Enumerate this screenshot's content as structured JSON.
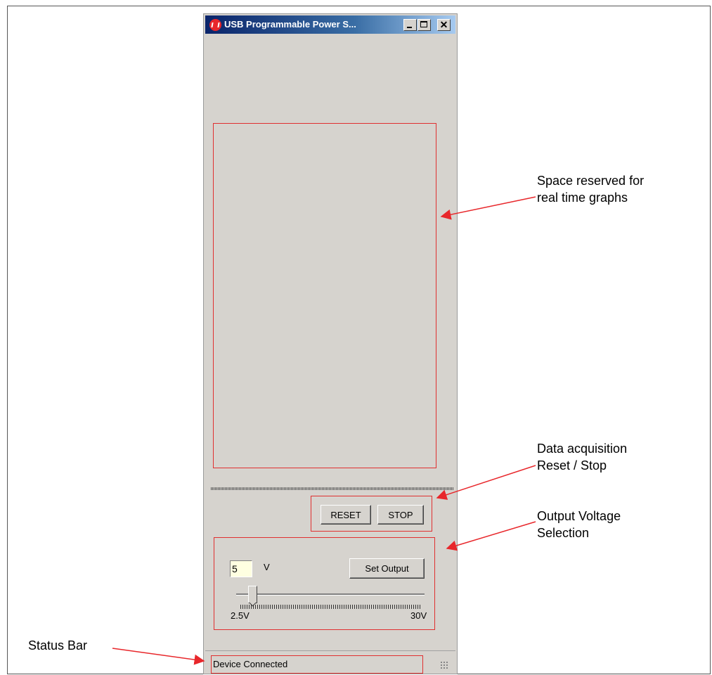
{
  "window": {
    "title": "USB Programmable Power S...",
    "logo_icon": "microchip-logo-icon",
    "titlebar_buttons": [
      "minimize",
      "maximize",
      "close"
    ],
    "close_glyph": "✕"
  },
  "controls": {
    "reset_label": "RESET",
    "stop_label": "STOP"
  },
  "voltage": {
    "value": "5",
    "unit": "V",
    "set_label": "Set Output",
    "slider": {
      "min_label": "2.5V",
      "max_label": "30V",
      "value": 5
    }
  },
  "status": {
    "text": "Device Connected"
  },
  "annotations": {
    "graphs": [
      "Space reserved for",
      "real time graphs"
    ],
    "daq": [
      "Data acquisition",
      "Reset / Stop"
    ],
    "output": [
      "Output Voltage",
      "Selection"
    ],
    "status": "Status Bar"
  },
  "colors": {
    "highlight": "#e03030",
    "window_bg": "#d6d3ce",
    "input_bg": "#ffffe1",
    "titlebar": "#0a246a"
  }
}
